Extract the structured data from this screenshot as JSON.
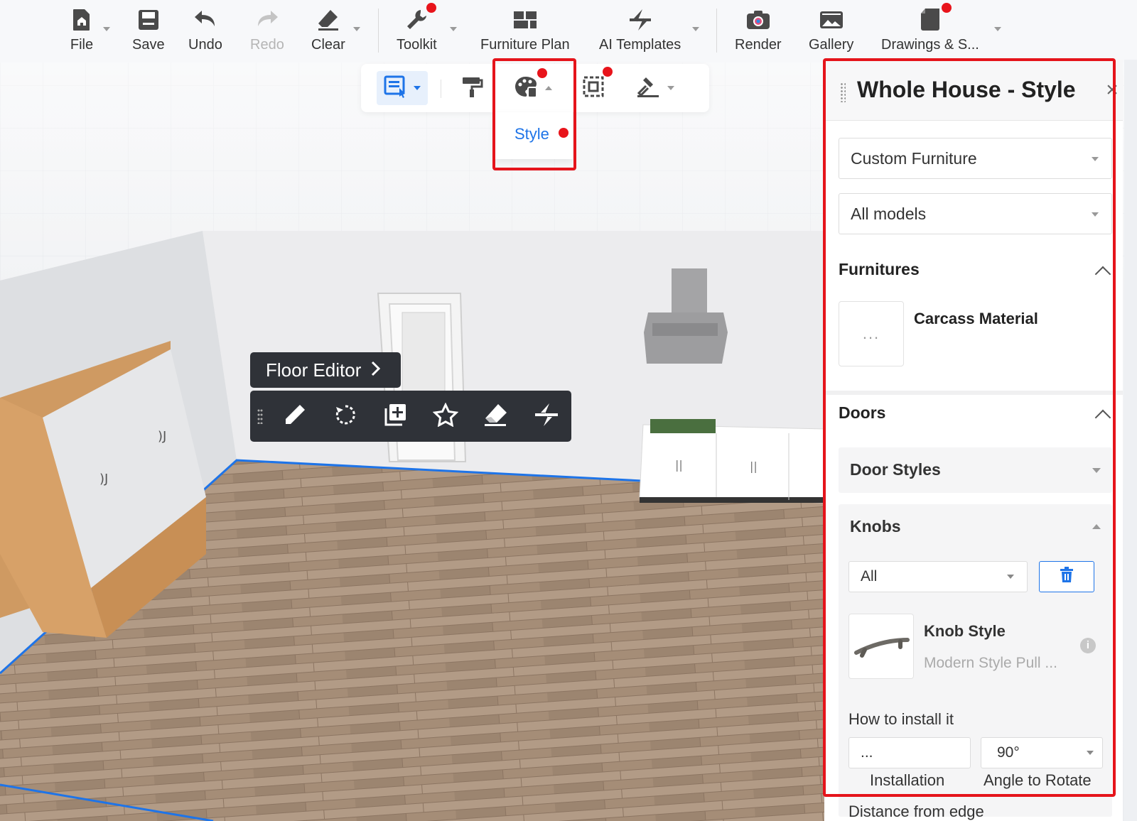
{
  "toolbar": {
    "file": "File",
    "save": "Save",
    "undo": "Undo",
    "redo": "Redo",
    "clear": "Clear",
    "toolkit": "Toolkit",
    "furniture_plan": "Furniture Plan",
    "ai_templates": "AI Templates",
    "render": "Render",
    "gallery": "Gallery",
    "drawings": "Drawings & S..."
  },
  "style_menu": {
    "item": "Style"
  },
  "floor_editor": {
    "title": "Floor Editor",
    "tools": [
      "pencil-icon",
      "rotate-icon",
      "add-copy-icon",
      "star-icon",
      "eraser-icon",
      "split-icon"
    ]
  },
  "panel": {
    "title": "Whole House - Style",
    "category_dropdown": "Custom Furniture",
    "model_dropdown": "All models",
    "furnitures": {
      "heading": "Furnitures",
      "item_label": "Carcass Material",
      "item_value": "..."
    },
    "doors": {
      "heading": "Doors",
      "door_styles": "Door Styles",
      "knobs": {
        "heading": "Knobs",
        "filter": "All",
        "knob_style_label": "Knob Style",
        "knob_style_value": "Modern Style Pull ...",
        "install_label": "How to install it",
        "installation_value": "...",
        "angle_value": "90°",
        "installation_caption": "Installation",
        "angle_caption": "Angle to Rotate",
        "distance_label": "Distance from edge"
      }
    }
  },
  "colors": {
    "accent": "#1e74e8",
    "highlight": "#e5141b",
    "dark_toolbar": "#2f3238"
  }
}
